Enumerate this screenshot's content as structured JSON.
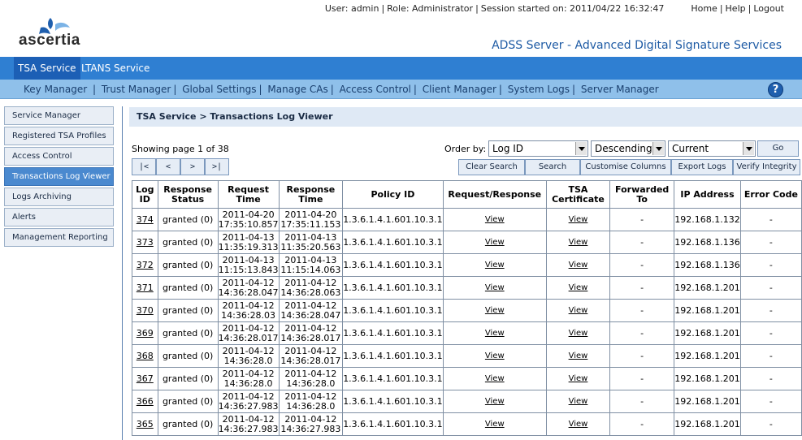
{
  "header": {
    "logo_text": "ascertia",
    "user_text": "User: admin",
    "role_text": "Role: Administrator",
    "session_text": "Session started on: 2011/04/22 16:32:47",
    "links": [
      "Home",
      "Help",
      "Logout"
    ],
    "product_title": "ADSS Server - Advanced Digital Signature Services"
  },
  "main_tabs": [
    "TSA Service",
    "LTANS Service"
  ],
  "subnav": [
    "Key Manager",
    "Trust Manager",
    "Global Settings",
    "Manage CAs",
    "Access Control",
    "Client Manager",
    "System Logs",
    "Server Manager"
  ],
  "sidebar": [
    "Service Manager",
    "Registered TSA Profiles",
    "Access Control",
    "Transactions Log Viewer",
    "Logs Archiving",
    "Alerts",
    "Management Reporting"
  ],
  "page_heading": "TSA Service > Transactions Log Viewer",
  "paging": {
    "text": "Showing page 1 of 38",
    "buttons": [
      "|<",
      "<",
      ">",
      ">|"
    ]
  },
  "order": {
    "label": "Order by:",
    "field": "Log ID",
    "direction": "Descending",
    "scope": "Current",
    "go_label": "Go"
  },
  "actions": [
    "Clear Search",
    "Search",
    "Customise Columns",
    "Export Logs",
    "Verify Integrity"
  ],
  "table": {
    "columns": [
      "Log ID",
      "Response Status",
      "Request Time",
      "Response Time",
      "Policy ID",
      "Request/Response",
      "TSA Certificate",
      "Forwarded To",
      "IP Address",
      "Error Code"
    ],
    "rows": [
      {
        "id": "374",
        "status": "granted (0)",
        "req_date": "2011-04-20",
        "req_time": "17:35:10.857",
        "resp_date": "2011-04-20",
        "resp_time": "17:35:11.153",
        "policy": "1.3.6.1.4.1.601.10.3.1",
        "rr": "View",
        "cert": "View",
        "fwd": "-",
        "ip": "192.168.1.132",
        "err": "-"
      },
      {
        "id": "373",
        "status": "granted (0)",
        "req_date": "2011-04-13",
        "req_time": "11:35:19.313",
        "resp_date": "2011-04-13",
        "resp_time": "11:35:20.563",
        "policy": "1.3.6.1.4.1.601.10.3.1",
        "rr": "View",
        "cert": "View",
        "fwd": "-",
        "ip": "192.168.1.136",
        "err": "-"
      },
      {
        "id": "372",
        "status": "granted (0)",
        "req_date": "2011-04-13",
        "req_time": "11:15:13.843",
        "resp_date": "2011-04-13",
        "resp_time": "11:15:14.063",
        "policy": "1.3.6.1.4.1.601.10.3.1",
        "rr": "View",
        "cert": "View",
        "fwd": "-",
        "ip": "192.168.1.136",
        "err": "-"
      },
      {
        "id": "371",
        "status": "granted (0)",
        "req_date": "2011-04-12",
        "req_time": "14:36:28.047",
        "resp_date": "2011-04-12",
        "resp_time": "14:36:28.063",
        "policy": "1.3.6.1.4.1.601.10.3.1",
        "rr": "View",
        "cert": "View",
        "fwd": "-",
        "ip": "192.168.1.201",
        "err": "-"
      },
      {
        "id": "370",
        "status": "granted (0)",
        "req_date": "2011-04-12",
        "req_time": "14:36:28.03",
        "resp_date": "2011-04-12",
        "resp_time": "14:36:28.047",
        "policy": "1.3.6.1.4.1.601.10.3.1",
        "rr": "View",
        "cert": "View",
        "fwd": "-",
        "ip": "192.168.1.201",
        "err": "-"
      },
      {
        "id": "369",
        "status": "granted (0)",
        "req_date": "2011-04-12",
        "req_time": "14:36:28.017",
        "resp_date": "2011-04-12",
        "resp_time": "14:36:28.017",
        "policy": "1.3.6.1.4.1.601.10.3.1",
        "rr": "View",
        "cert": "View",
        "fwd": "-",
        "ip": "192.168.1.201",
        "err": "-"
      },
      {
        "id": "368",
        "status": "granted (0)",
        "req_date": "2011-04-12",
        "req_time": "14:36:28.0",
        "resp_date": "2011-04-12",
        "resp_time": "14:36:28.017",
        "policy": "1.3.6.1.4.1.601.10.3.1",
        "rr": "View",
        "cert": "View",
        "fwd": "-",
        "ip": "192.168.1.201",
        "err": "-"
      },
      {
        "id": "367",
        "status": "granted (0)",
        "req_date": "2011-04-12",
        "req_time": "14:36:28.0",
        "resp_date": "2011-04-12",
        "resp_time": "14:36:28.0",
        "policy": "1.3.6.1.4.1.601.10.3.1",
        "rr": "View",
        "cert": "View",
        "fwd": "-",
        "ip": "192.168.1.201",
        "err": "-"
      },
      {
        "id": "366",
        "status": "granted (0)",
        "req_date": "2011-04-12",
        "req_time": "14:36:27.983",
        "resp_date": "2011-04-12",
        "resp_time": "14:36:28.0",
        "policy": "1.3.6.1.4.1.601.10.3.1",
        "rr": "View",
        "cert": "View",
        "fwd": "-",
        "ip": "192.168.1.201",
        "err": "-"
      },
      {
        "id": "365",
        "status": "granted (0)",
        "req_date": "2011-04-12",
        "req_time": "14:36:27.983",
        "resp_date": "2011-04-12",
        "resp_time": "14:36:27.983",
        "policy": "1.3.6.1.4.1.601.10.3.1",
        "rr": "View",
        "cert": "View",
        "fwd": "-",
        "ip": "192.168.1.201",
        "err": "-"
      }
    ]
  }
}
